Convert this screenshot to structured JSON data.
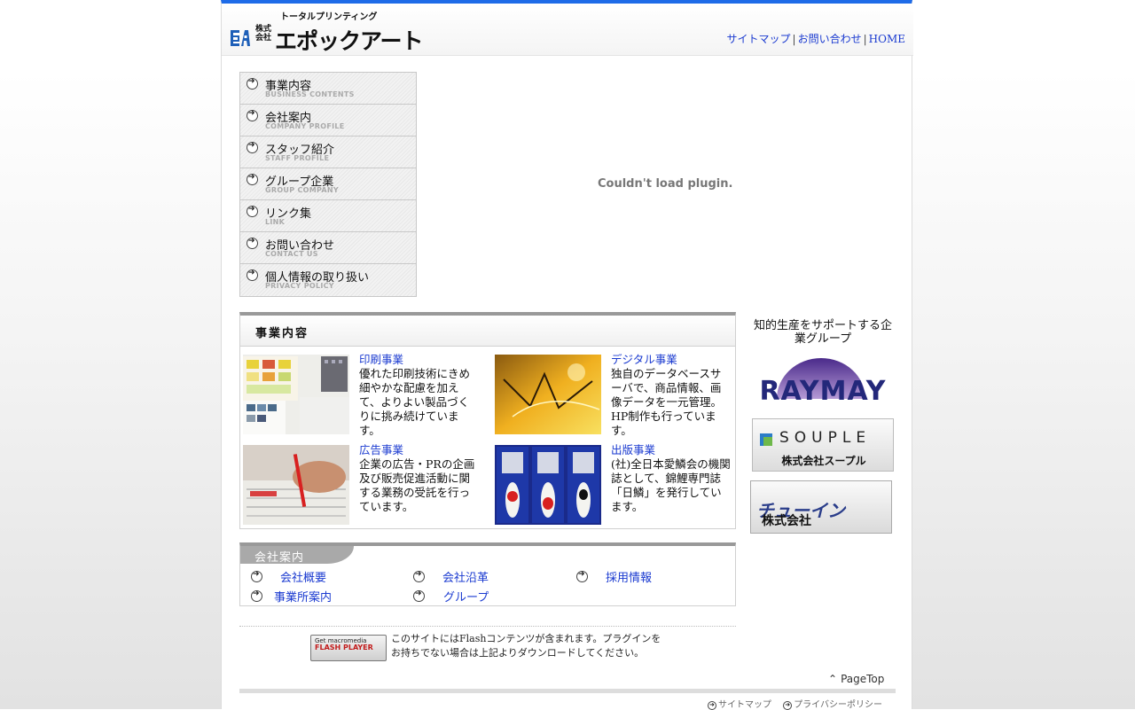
{
  "header": {
    "logo_sub": "トータルプリンティング",
    "logo_small": "株式会社",
    "logo_main": "エポックアート",
    "links": [
      "サイトマップ",
      "お問い合わせ",
      "HOME"
    ],
    "separator": "|"
  },
  "menu": [
    {
      "jp": "事業内容",
      "en": "BUSINESS CONTENTS"
    },
    {
      "jp": "会社案内",
      "en": "COMPANY PROFILE"
    },
    {
      "jp": "スタッフ紹介",
      "en": "STAFF PROFILE"
    },
    {
      "jp": "グループ企業",
      "en": "GROUP COMPANY"
    },
    {
      "jp": "リンク集",
      "en": "LINK"
    },
    {
      "jp": "お問い合わせ",
      "en": "CONTACT US"
    },
    {
      "jp": "個人情報の取り扱い",
      "en": "PRIVACY POLICY"
    }
  ],
  "plugin_message": "Couldn't load plugin.",
  "business": {
    "title": "事業内容",
    "items": [
      {
        "title": "印刷事業",
        "desc": "優れた印刷技術にきめ細やかな配慮を加えて、よりよい製品づくりに挑み続けています。"
      },
      {
        "title": "デジタル事業",
        "desc": "独自のデータベースサーバで、商品情報、画像データを一元管理。HP制作も行っています。"
      },
      {
        "title": "広告事業",
        "desc": "企業の広告・PRの企画及び販売促進活動に関する業務の受託を行っています。"
      },
      {
        "title": "出版事業",
        "desc": "(社)全日本愛鱗会の機関誌として、錦鯉専門誌「日鱗」を発行しています。"
      }
    ]
  },
  "company": {
    "title": "会社案内",
    "links": [
      "会社概要",
      "会社沿革",
      "採用情報",
      "事業所案内",
      "グループ"
    ]
  },
  "flash": {
    "badge_line1": "Get macromedia",
    "badge_line2": "FLASH PLAYER",
    "note": "このサイトにはFlashコンテンツが含まれます。プラグインをお持ちでない場合は上記よりダウンロードしてください。"
  },
  "sidebar": {
    "title": "知的生産をサポートする企業グループ",
    "raymay": "RAYMAY",
    "souple_word": "SOUPLE",
    "souple_company": "株式会社スープル",
    "chuin_prefix": "株式会社",
    "chuin_name": "チューイン"
  },
  "footer": {
    "pagetop": "PageTop",
    "links": [
      "サイトマップ",
      "プライバシーポリシー"
    ]
  }
}
